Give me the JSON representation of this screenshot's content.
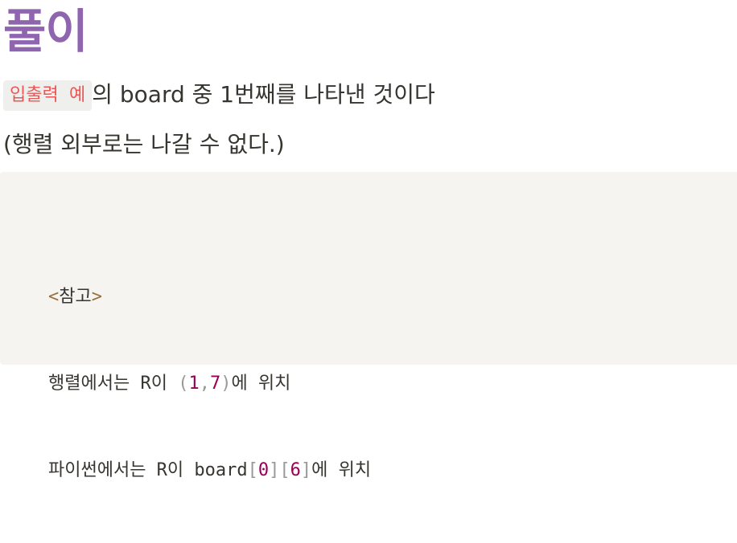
{
  "heading": "풀이",
  "paragraph1": {
    "inline_code": "입출력 예",
    "text": "의 board 중 1번째를 나타낸 것이다"
  },
  "paragraph2": "(행렬 외부로는 나갈 수 없다.)",
  "code_block": {
    "line1": {
      "open_bracket": "<",
      "text": "참고",
      "close_bracket": ">"
    },
    "line2": {
      "prefix": "행렬에서는 R이 ",
      "open_paren": "(",
      "num1": "1",
      "comma": ",",
      "num2": "7",
      "close_paren": ")",
      "suffix": "에 위치"
    },
    "line3": {
      "prefix": "파이썬에서는 R이 board",
      "open1": "[",
      "num1": "0",
      "close1": "]",
      "open2": "[",
      "num2": "6",
      "close2": "]",
      "suffix": "에 위치"
    }
  }
}
